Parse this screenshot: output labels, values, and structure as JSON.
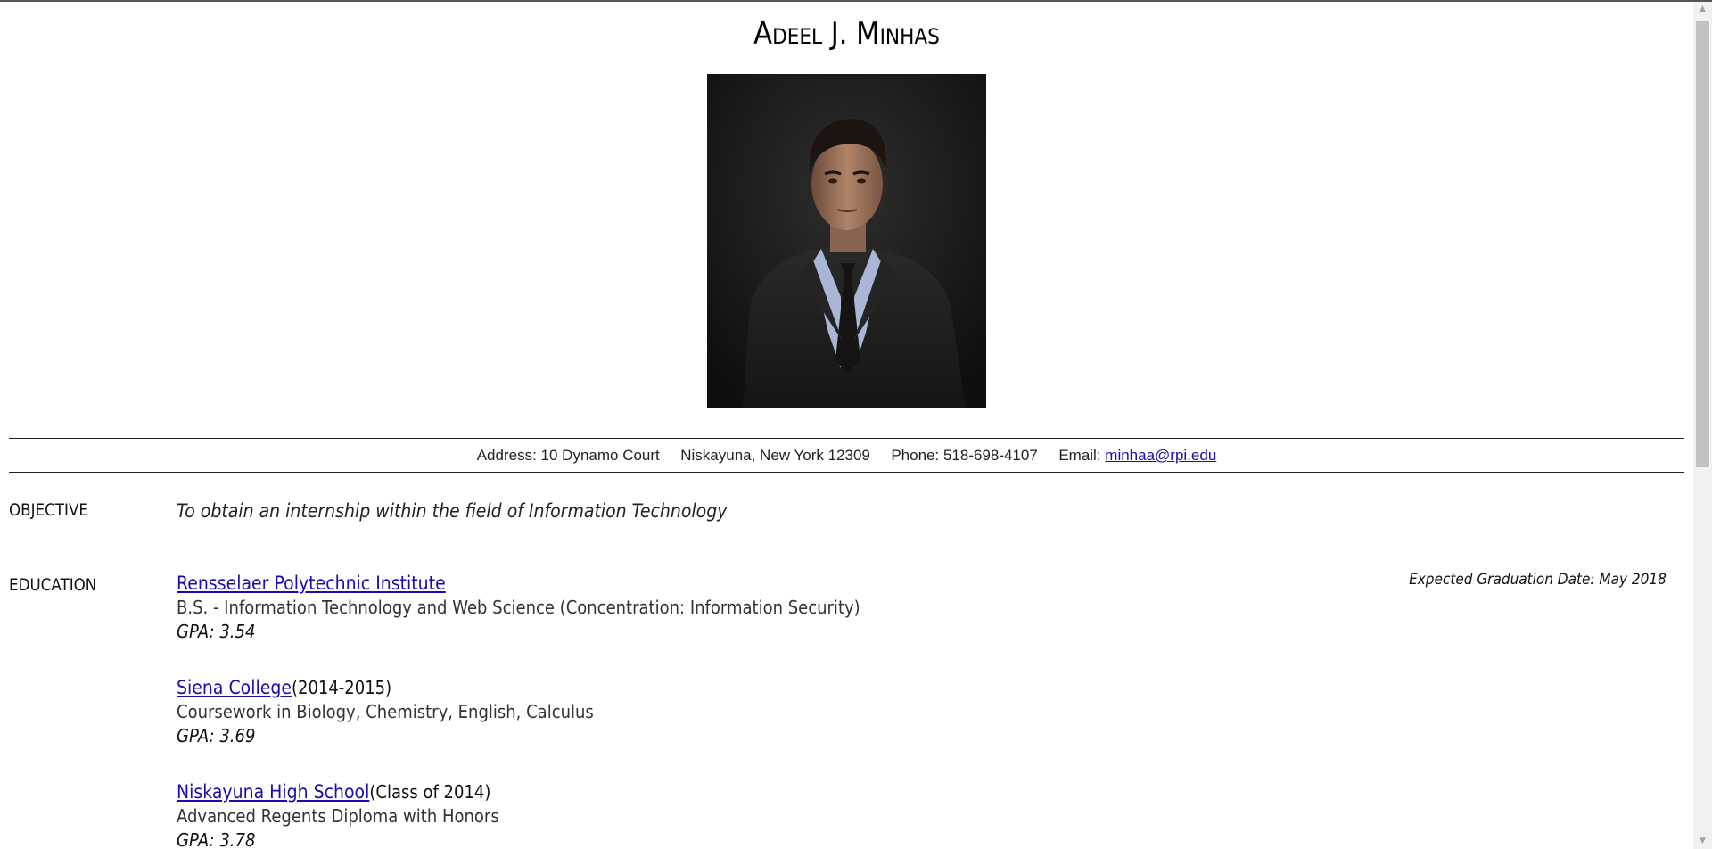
{
  "header": {
    "name": "Adeel J. Minhas"
  },
  "contact": {
    "address_label": "Address:",
    "address": "10 Dynamo Court",
    "city": "Niskayuna, New York 12309",
    "phone_label": "Phone:",
    "phone": "518-698-4107",
    "email_label": "Email:",
    "email": "minhaa@rpi.edu"
  },
  "objective": {
    "label": "OBJECTIVE",
    "text": "To obtain an internship within the field of Information Technology"
  },
  "education": {
    "label": "EDUCATION",
    "graduation": "Expected Graduation Date: May 2018",
    "schools": [
      {
        "name": "Rensselaer Polytechnic Institute",
        "suffix": "",
        "desc": "B.S. - Information Technology and Web Science (Concentration: Information Security)",
        "gpa": "GPA: 3.54"
      },
      {
        "name": "Siena College",
        "suffix": "(2014-2015)",
        "desc": "Coursework in Biology, Chemistry, English, Calculus",
        "gpa": "GPA: 3.69"
      },
      {
        "name": "Niskayuna High School",
        "suffix": "(Class of 2014)",
        "desc": "Advanced Regents Diploma with Honors",
        "gpa": "GPA: 3.78"
      }
    ]
  },
  "colors": {
    "link": "#1a0dab",
    "photo_background": "#1a1a1a"
  }
}
